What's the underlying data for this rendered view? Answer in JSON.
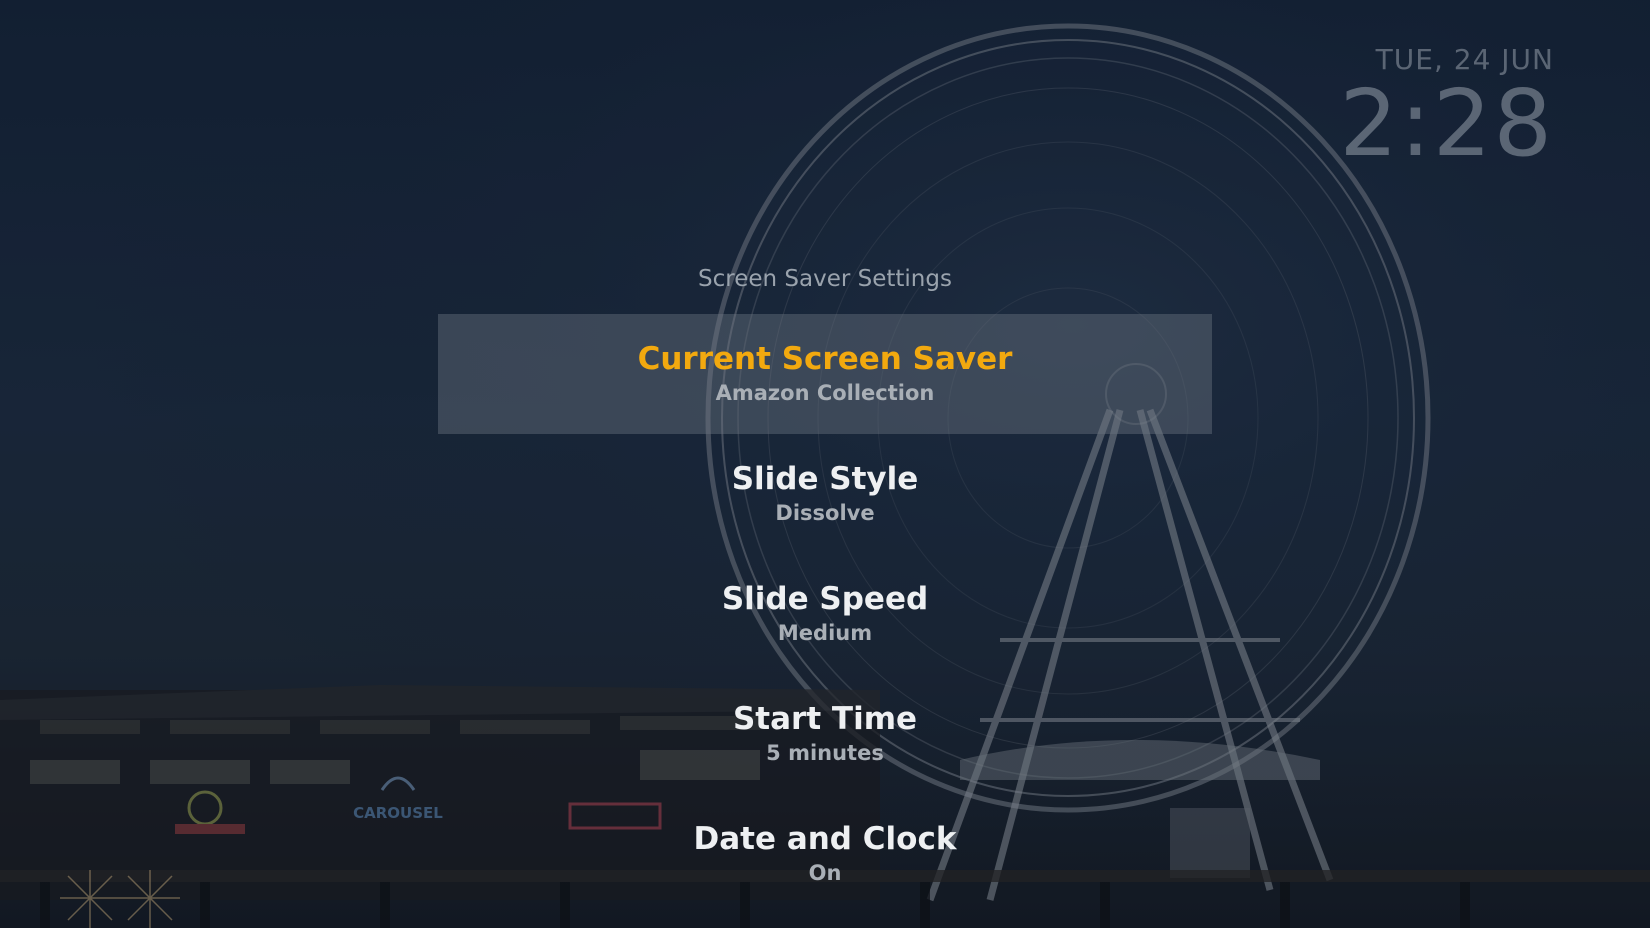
{
  "clock": {
    "date": "TUE, 24 JUN",
    "time": "2:28"
  },
  "panel": {
    "title": "Screen Saver Settings"
  },
  "menu": {
    "selected_index": 0,
    "accent_color": "#f2a90f",
    "items": [
      {
        "label": "Current Screen Saver",
        "value": "Amazon Collection"
      },
      {
        "label": "Slide Style",
        "value": "Dissolve"
      },
      {
        "label": "Slide Speed",
        "value": "Medium"
      },
      {
        "label": "Start Time",
        "value": "5 minutes"
      },
      {
        "label": "Date and Clock",
        "value": "On"
      }
    ]
  },
  "background": {
    "signs": [
      "CAROUSEL"
    ]
  }
}
